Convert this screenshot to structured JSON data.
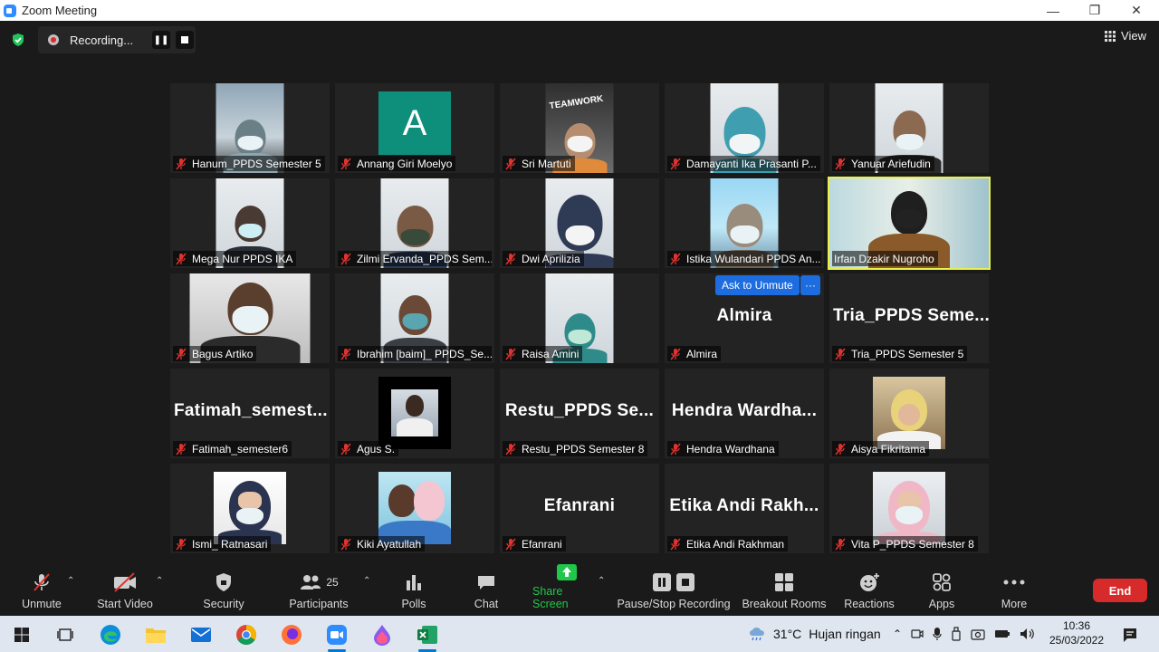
{
  "window": {
    "title": "Zoom Meeting"
  },
  "recording": {
    "label": "Recording..."
  },
  "view_label": "View",
  "tiles": [
    {
      "name": "Hanum_PPDS Semester 5"
    },
    {
      "name": "Annang Giri Moelyo",
      "avatar_letter": "A"
    },
    {
      "name": "Sri Martuti",
      "photo_text": "TEAMWORK"
    },
    {
      "name": "Damayanti Ika Prasanti P..."
    },
    {
      "name": "Yanuar Ariefudin"
    },
    {
      "name": "Mega Nur PPDS IKA"
    },
    {
      "name": "Zilmi Ervanda_PPDS Sem..."
    },
    {
      "name": "Dwi Aprilizia"
    },
    {
      "name": "Istika Wulandari PPDS An..."
    },
    {
      "name": "Irfan Dzakir Nugroho"
    },
    {
      "name": "Bagus Artiko"
    },
    {
      "name": "Ibrahim [baim]_ PPDS_Se..."
    },
    {
      "name": "Raisa Amini"
    },
    {
      "name": "Almira",
      "display_name": "Almira",
      "ask_to_unmute": "Ask to Unmute",
      "more": "···"
    },
    {
      "name": "Tria_PPDS Semester 5",
      "display_name": "Tria_PPDS  Seme..."
    },
    {
      "name": "Fatimah_semester6",
      "display_name": "Fatimah_semest..."
    },
    {
      "name": "Agus S."
    },
    {
      "name": "Restu_PPDS Semester 8",
      "display_name": "Restu_PPDS  Se..."
    },
    {
      "name": "Hendra Wardhana",
      "display_name": "Hendra  Wardha..."
    },
    {
      "name": "Aisya Fikritama"
    },
    {
      "name": "Ismi_ Ratnasari"
    },
    {
      "name": "Kiki Ayatullah"
    },
    {
      "name": "Efanrani",
      "display_name": "Efanrani"
    },
    {
      "name": "Etika Andi Rakhman",
      "display_name": "Etika  Andi  Rakh..."
    },
    {
      "name": "Vita P_PPDS Semester 8"
    }
  ],
  "toolbar": {
    "unmute": "Unmute",
    "start_video": "Start Video",
    "security": "Security",
    "participants": "Participants",
    "participants_count": "25",
    "polls": "Polls",
    "chat": "Chat",
    "share_screen": "Share Screen",
    "pause_stop_recording": "Pause/Stop Recording",
    "breakout_rooms": "Breakout Rooms",
    "reactions": "Reactions",
    "apps": "Apps",
    "more": "More",
    "end": "End"
  },
  "taskbar": {
    "weather_temp": "31°C",
    "weather_desc": "Hujan ringan",
    "time": "10:36",
    "date": "25/03/2022"
  },
  "colors": {
    "active_speaker": "#e8f04c",
    "share_green": "#20c74a",
    "end_red": "#d72b2b",
    "blue_button": "#1d6ce0",
    "muted_red": "#e0322f"
  }
}
